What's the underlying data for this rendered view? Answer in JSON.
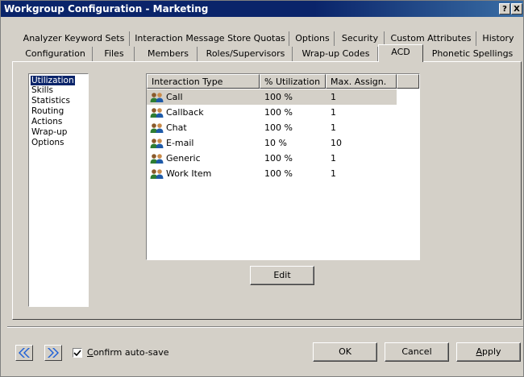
{
  "window": {
    "title": "Workgroup Configuration - Marketing",
    "help_button": "?",
    "close_button": "X"
  },
  "tabs_row1": [
    {
      "label": "Analyzer Keyword Sets"
    },
    {
      "label": "Interaction Message Store Quotas"
    },
    {
      "label": "Options"
    },
    {
      "label": "Security"
    },
    {
      "label": "Custom Attributes"
    },
    {
      "label": "History"
    }
  ],
  "tabs_row2": [
    {
      "label": "Configuration"
    },
    {
      "label": "Files"
    },
    {
      "label": "Members"
    },
    {
      "label": "Roles/Supervisors"
    },
    {
      "label": "Wrap-up Codes"
    },
    {
      "label": "ACD",
      "active": true
    },
    {
      "label": "Phonetic Spellings"
    }
  ],
  "sidebar": {
    "items": [
      {
        "label": "Utilization",
        "selected": true
      },
      {
        "label": "Skills"
      },
      {
        "label": "Statistics"
      },
      {
        "label": "Routing"
      },
      {
        "label": "Actions"
      },
      {
        "label": "Wrap-up"
      },
      {
        "label": "Options"
      }
    ]
  },
  "table": {
    "columns": [
      "Interaction Type",
      "% Utilization",
      "Max. Assign."
    ],
    "rows": [
      {
        "type": "Call",
        "utilization": "100 %",
        "max_assign": "1",
        "selected": true
      },
      {
        "type": "Callback",
        "utilization": "100 %",
        "max_assign": "1"
      },
      {
        "type": "Chat",
        "utilization": "100 %",
        "max_assign": "1"
      },
      {
        "type": "E-mail",
        "utilization": "10 %",
        "max_assign": "10"
      },
      {
        "type": "Generic",
        "utilization": "100 %",
        "max_assign": "1"
      },
      {
        "type": "Work Item",
        "utilization": "100 %",
        "max_assign": "1"
      }
    ],
    "row_icon": "users-group-icon"
  },
  "buttons": {
    "edit": "Edit",
    "ok": "OK",
    "cancel": "Cancel",
    "apply_underlined": "A",
    "apply_rest": "pply"
  },
  "footer": {
    "confirm_autosave_underlined": "C",
    "confirm_autosave_rest": "onfirm auto-save",
    "confirm_autosave_checked": true,
    "prev_icon": "double-chevron-left-icon",
    "next_icon": "double-chevron-right-icon"
  },
  "colors": {
    "titlebar": "#0a246a",
    "face": "#d4d0c8",
    "selection": "#0a246a",
    "nav_arrow": "#1c5fd8"
  }
}
